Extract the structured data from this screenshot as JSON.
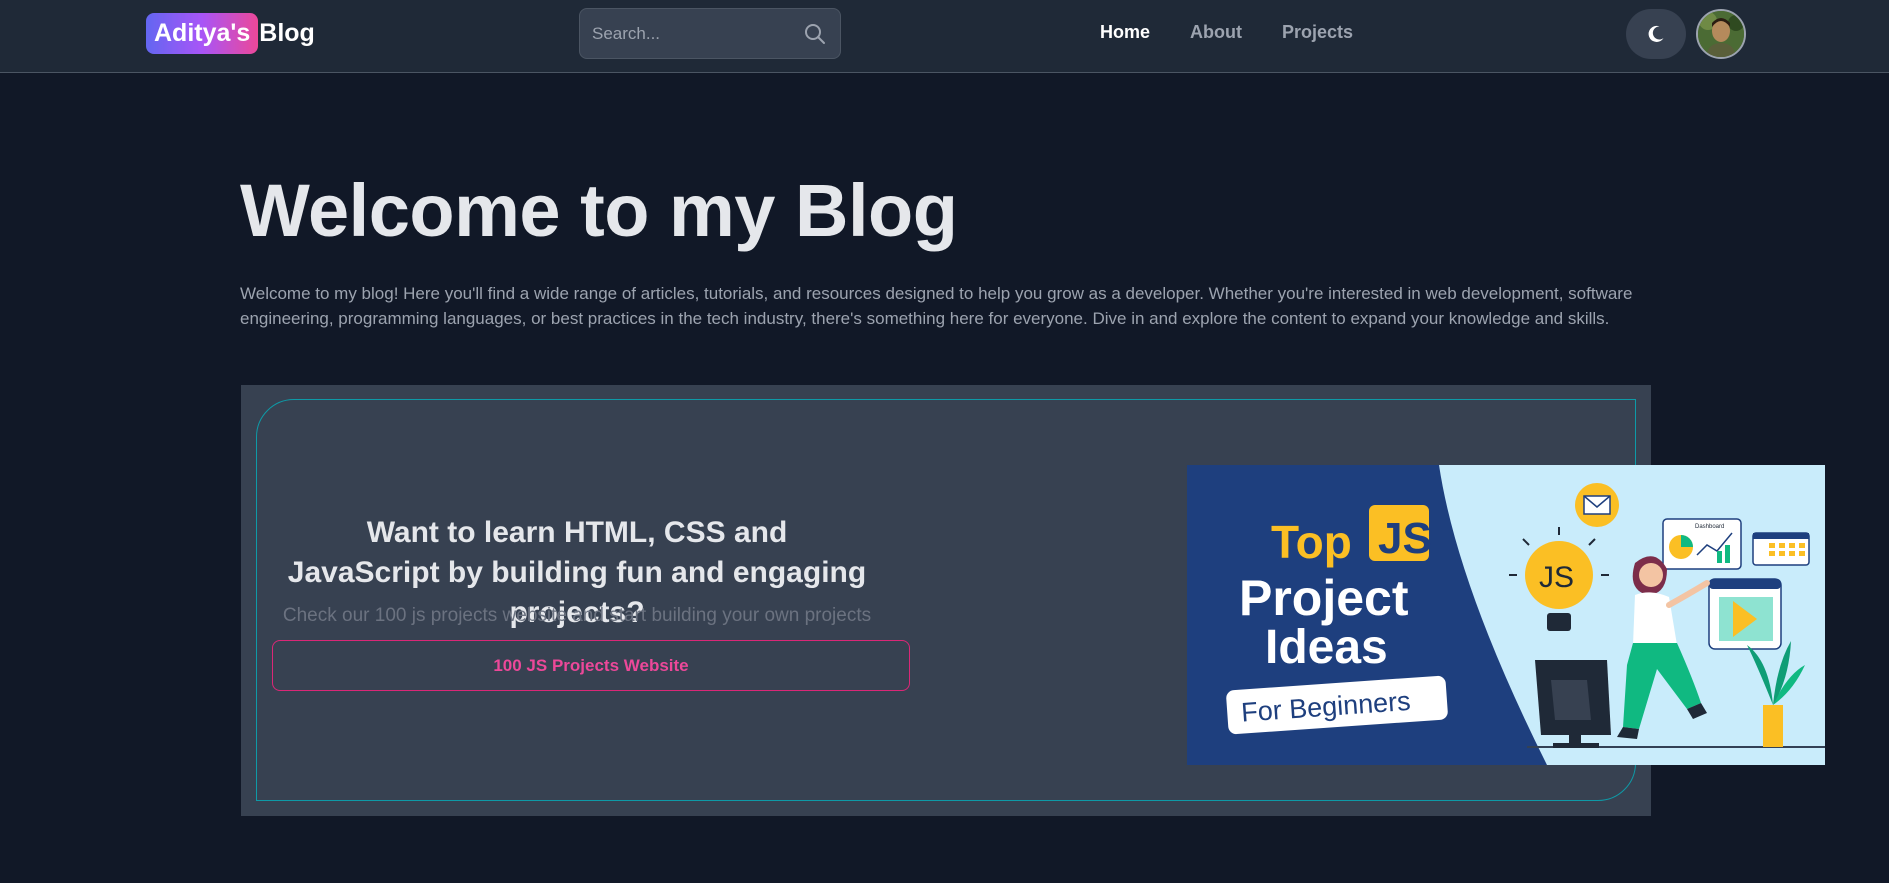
{
  "navbar": {
    "brand_highlight": "Aditya's",
    "brand_rest": "Blog",
    "search_placeholder": "Search...",
    "links": [
      {
        "label": "Home",
        "active": true
      },
      {
        "label": "About",
        "active": false
      },
      {
        "label": "Projects",
        "active": false
      }
    ],
    "theme_icon": "moon-icon",
    "avatar_icon": "user-avatar"
  },
  "hero": {
    "title": "Welcome to my Blog",
    "description": "Welcome to my blog! Here you'll find a wide range of articles, tutorials, and resources designed to help you grow as a developer. Whether you're interested in web development, software engineering, programming languages, or best practices in the tech industry, there's something here for everyone. Dive in and explore the content to expand your knowledge and skills."
  },
  "promo": {
    "heading": "Want to learn HTML, CSS and JavaScript by building fun and engaging projects?",
    "subtext": "Check our 100 js projects website and start building your own projects",
    "button_label": "100 JS Projects Website",
    "image": {
      "line1_top": "Top",
      "line1_badge": "JS",
      "line2": "Project",
      "line3": "Ideas",
      "tag": "For Beginners",
      "bulb_label": "JS",
      "dashboard_label": "Dashboard"
    }
  },
  "colors": {
    "background": "#111827",
    "navbar": "#1f2937",
    "card": "#374151",
    "accent_pink": "#ec4899",
    "accent_teal": "#0e9aa7",
    "brand_gradient": [
      "#6366f1",
      "#a855f7",
      "#ec4899"
    ]
  }
}
